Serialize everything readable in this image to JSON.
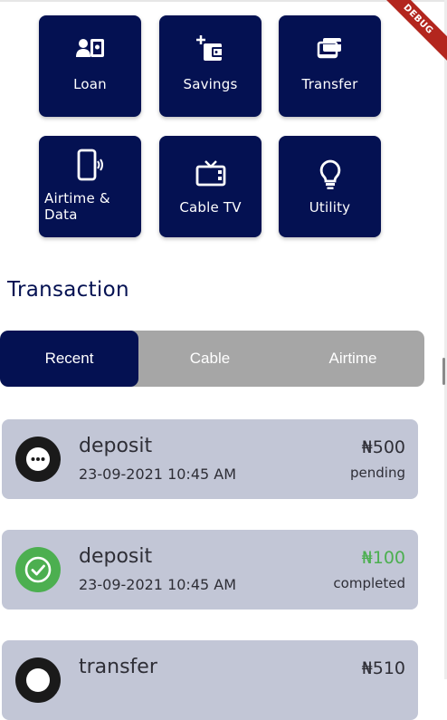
{
  "services": [
    {
      "id": "loan",
      "label": "Loan",
      "icon": "id-card-icon"
    },
    {
      "id": "savings",
      "label": "Savings",
      "icon": "wallet-add-icon"
    },
    {
      "id": "transfer",
      "label": "Transfer",
      "icon": "transfer-cards-icon"
    },
    {
      "id": "airtime",
      "label": "Airtime & Data",
      "line1": "Airtime &",
      "line2": "Data",
      "icon": "phone-signal-icon"
    },
    {
      "id": "cable",
      "label": "Cable TV",
      "icon": "tv-icon"
    },
    {
      "id": "utility",
      "label": "Utility",
      "icon": "lightbulb-icon"
    }
  ],
  "debug_banner": "DEBUG",
  "section_title": "Transaction",
  "tabs": [
    {
      "label": "Recent",
      "active": true
    },
    {
      "label": "Cable",
      "active": false
    },
    {
      "label": "Airtime",
      "active": false
    }
  ],
  "transactions": [
    {
      "title": "deposit",
      "date": "23-09-2021 10:45 AM",
      "amount": "₦500",
      "status": "pending",
      "icon": "more-dots-icon"
    },
    {
      "title": "deposit",
      "date": "23-09-2021 10:45 AM",
      "amount": "₦100",
      "status": "completed",
      "icon": "check-circle-icon"
    },
    {
      "title": "transfer",
      "date": "",
      "amount": "₦510",
      "status": "",
      "icon": "transfer-status-icon"
    }
  ],
  "colors": {
    "primary": "#041152",
    "card_bg": "#c2c6d6",
    "tab_bg": "#a6a6a6",
    "success": "#4caf50",
    "pending": "#1a1a1a",
    "debug": "#b3261e"
  }
}
